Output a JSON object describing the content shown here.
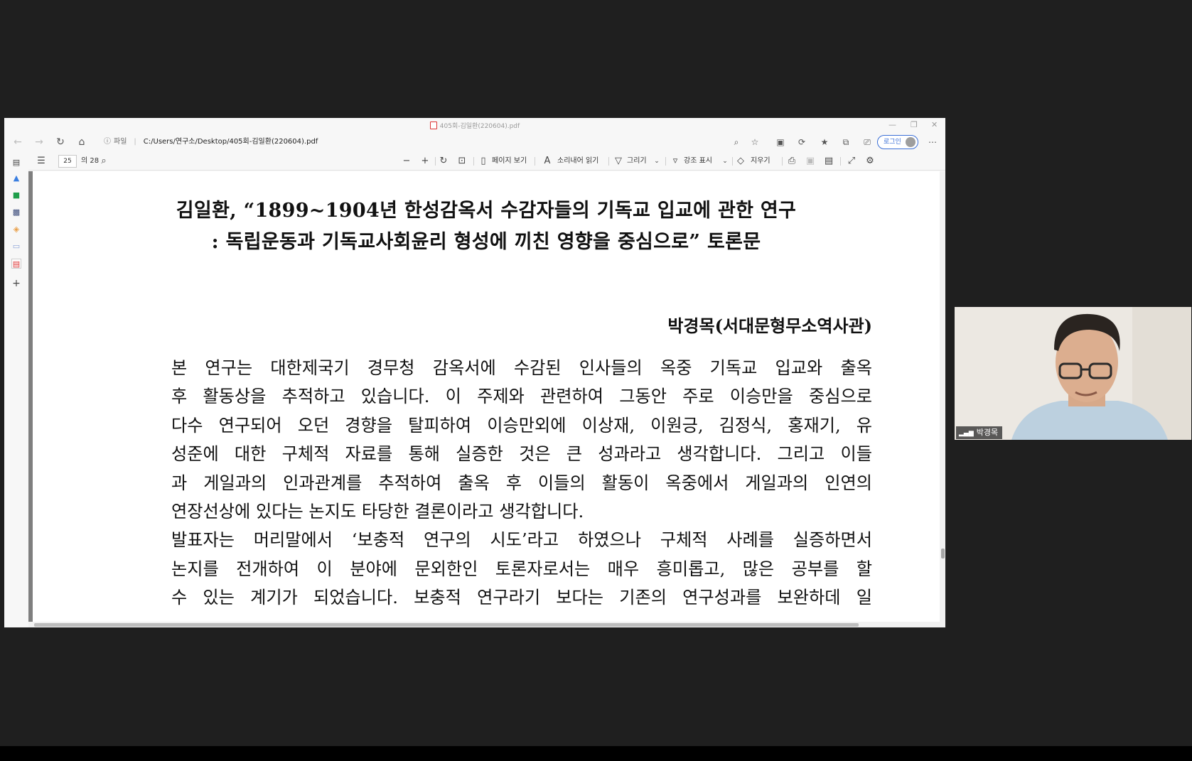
{
  "window": {
    "title": "405회-김일환(220604).pdf",
    "url_scheme": "파일",
    "url_path": "C:/Users/연구소/Desktop/405회-김일환(220604).pdf",
    "login_label": "로그인"
  },
  "pdf_toolbar": {
    "current_page": "25",
    "total_pages": "의 28",
    "page_view_label": "페이지 보기",
    "read_aloud_label": "소리내어 읽기",
    "draw_label": "그리기",
    "highlight_label": "강조 표시",
    "erase_label": "지우기"
  },
  "document": {
    "title_line1": "김일환, “1899~1904년 한성감옥서 수감자들의 기독교 입교에 관한 연구",
    "title_line2": ": 독립운동과 기독교사회윤리 형성에 끼친 영향을 중심으로” 토론문",
    "author": "박경목(서대문형무소역사관)",
    "lines": [
      "  본 연구는 대한제국기 경무청 감옥서에 수감된 인사들의 옥중 기독교 입교와 출옥",
      "후 활동상을 추적하고 있습니다. 이 주제와 관련하여 그동안 주로 이승만을 중심으로",
      "다수 연구되어 오던 경향을 탈피하여 이승만외에 이상재, 이원긍, 김정식, 홍재기, 유",
      "성준에 대한 구체적 자료를 통해 실증한 것은 큰 성과라고 생각합니다. 그리고 이들",
      "과 게일과의 인과관계를 추적하여 출옥 후 이들의 활동이 옥중에서 게일과의 인연의",
      "연장선상에 있다는 논지도 타당한 결론이라고 생각합니다.",
      "  발표자는 머리말에서 ‘보충적 연구의 시도’라고 하였으나 구체적 사례를 실증하면서",
      "논지를 전개하여 이 분야에 문외한인 토론자로서는 매우 흥미롭고, 많은 공부를 할",
      "수 있는 계기가 되었습니다. 보충적 연구라기 보다는 기존의 연구성과를 보완하데 일"
    ]
  },
  "video": {
    "participant_name": "박경목"
  }
}
